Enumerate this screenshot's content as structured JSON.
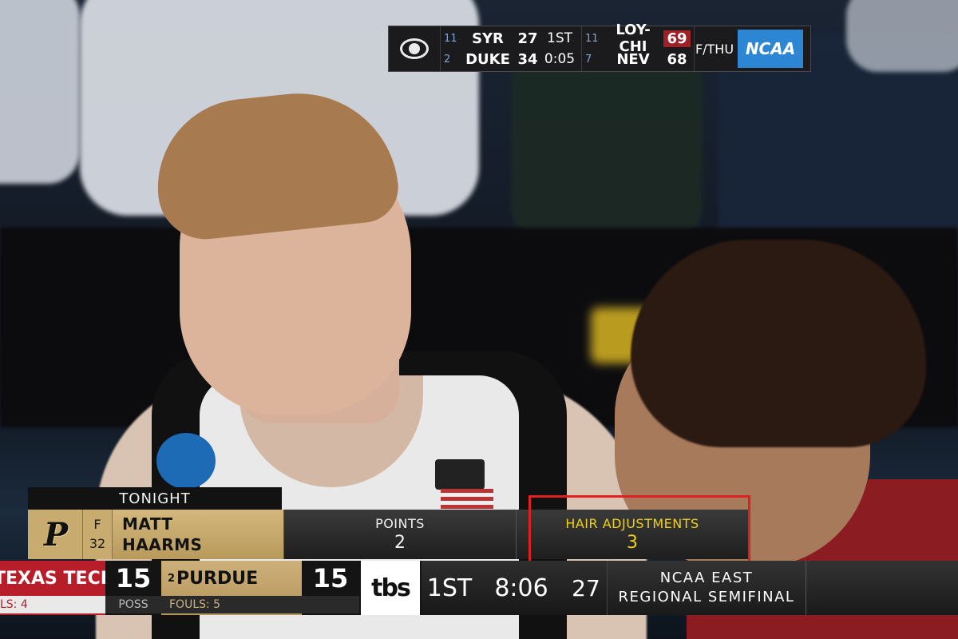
{
  "top_scoreboard": {
    "network_icon": "cbs-eye-icon",
    "game1": {
      "teams": [
        {
          "seed": "11",
          "name": "SYR",
          "score": "27"
        },
        {
          "seed": "2",
          "name": "DUKE",
          "score": "34"
        }
      ],
      "period": "1ST",
      "clock": "0:05"
    },
    "game2": {
      "teams": [
        {
          "seed": "11",
          "name": "LOY-CHI",
          "score": "69"
        },
        {
          "seed": "7",
          "name": "NEV",
          "score": "68"
        }
      ]
    },
    "final_label": "F/THU",
    "league_logo": "NCAA"
  },
  "lower_third": {
    "header": "TONIGHT",
    "team_logo": "P",
    "position": "F",
    "number": "32",
    "first_name": "MATT",
    "last_name": "HAARMS",
    "stats": [
      {
        "label": "POINTS",
        "value": "2"
      },
      {
        "label": "HAIR ADJUSTMENTS",
        "value": "3"
      }
    ]
  },
  "bug": {
    "away": {
      "name": "TEXAS TECH",
      "score": "15",
      "fouls": "LS: 4",
      "poss_label": "POSS"
    },
    "home": {
      "seed": "2",
      "name": "PURDUE",
      "score": "15",
      "fouls": "FOULS: 5"
    },
    "network": "tbs",
    "period": "1ST",
    "clock": "8:06",
    "shot_clock": "27",
    "round_line1": "NCAA EAST",
    "round_line2": "REGIONAL SEMIFINAL"
  },
  "colors": {
    "highlight_box": "#e02020",
    "stat_highlight": "#f0d016",
    "purdue_gold": "#c8ab6f",
    "texas_tech_red": "#b81e2a",
    "ncaa_blue": "#2d86d3"
  }
}
